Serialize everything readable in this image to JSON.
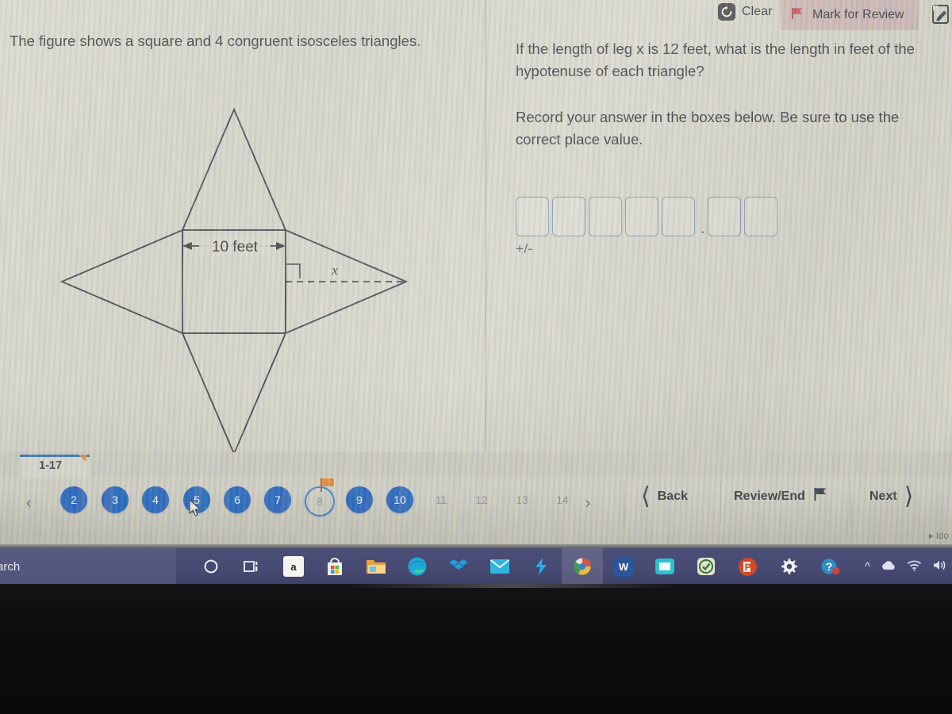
{
  "toolbar": {
    "clear_label": "Clear",
    "clear_icon": "undo-circular-arrow-icon",
    "mark_label": "Mark for Review",
    "mark_icon": "flag-icon",
    "edit_icon": "notepad-pencil-icon"
  },
  "question": {
    "left_text": "The figure shows a square and 4 congruent isosceles triangles.",
    "prompt": "If the length of leg x is 12 feet, what is the length in feet of the hypotenuse of each triangle?",
    "instruction": "Record your answer in the boxes below. Be sure to use the correct place value."
  },
  "figure": {
    "square_label": "10 feet",
    "leg_label": "x",
    "right_angle_marker": "right-angle-icon",
    "description": "square with four congruent isosceles triangles on each side"
  },
  "answer": {
    "whole_boxes": [
      "",
      "",
      "",
      "",
      ""
    ],
    "decimal_separator": ".",
    "fraction_boxes": [
      "",
      ""
    ],
    "sign_label": "+/-"
  },
  "nav": {
    "tab_label": "1-17",
    "prev_chevron": "‹",
    "next_chevron": "›",
    "pages": [
      {
        "num": "2",
        "state": "answered"
      },
      {
        "num": "3",
        "state": "answered"
      },
      {
        "num": "4",
        "state": "answered"
      },
      {
        "num": "5",
        "state": "answered"
      },
      {
        "num": "6",
        "state": "answered"
      },
      {
        "num": "7",
        "state": "answered"
      },
      {
        "num": "8",
        "state": "current",
        "flagged": true
      },
      {
        "num": "9",
        "state": "answered"
      },
      {
        "num": "10",
        "state": "answered"
      },
      {
        "num": "11",
        "state": "unanswered"
      },
      {
        "num": "12",
        "state": "unanswered"
      },
      {
        "num": "13",
        "state": "unanswered"
      },
      {
        "num": "14",
        "state": "unanswered"
      }
    ],
    "back_label": "Back",
    "review_label": "Review/End",
    "review_icon": "flag-icon",
    "next_label": "Next",
    "status_text": "ldo"
  },
  "taskbar": {
    "search_text": "arch",
    "icons": [
      {
        "name": "cortana-icon",
        "glyph": "O"
      },
      {
        "name": "task-view-icon",
        "glyph": "☰"
      },
      {
        "name": "amazon-icon",
        "glyph": "a"
      },
      {
        "name": "microsoft-store-icon",
        "glyph": "⊞"
      },
      {
        "name": "file-explorer-icon",
        "glyph": "▭"
      },
      {
        "name": "microsoft-edge-icon",
        "glyph": "e"
      },
      {
        "name": "dropbox-icon",
        "glyph": "❖"
      },
      {
        "name": "mail-icon",
        "glyph": "✉"
      },
      {
        "name": "skype-icon",
        "glyph": "⚡"
      },
      {
        "name": "browser-app-icon",
        "glyph": "●",
        "active": true
      },
      {
        "name": "word-icon",
        "glyph": "W"
      },
      {
        "name": "video-app-icon",
        "glyph": "▣"
      },
      {
        "name": "check-app-icon",
        "glyph": "✓"
      },
      {
        "name": "powerpoint-icon",
        "glyph": "P"
      },
      {
        "name": "settings-gear-icon",
        "glyph": "⚙"
      },
      {
        "name": "help-icon",
        "glyph": "?"
      }
    ],
    "tray": [
      {
        "name": "show-hidden-icons",
        "glyph": "∧"
      },
      {
        "name": "onedrive-cloud-icon",
        "glyph": "☁"
      },
      {
        "name": "wifi-icon",
        "glyph": "◔"
      },
      {
        "name": "volume-icon",
        "glyph": "◂"
      }
    ]
  },
  "colors": {
    "accent_blue": "#1f62c0",
    "current_ring": "#2f7fd0",
    "flag_orange": "#e8892e",
    "mark_review_bg": "#ba8a92",
    "taskbar": "#474a72",
    "surface": "#d2d1c4"
  }
}
